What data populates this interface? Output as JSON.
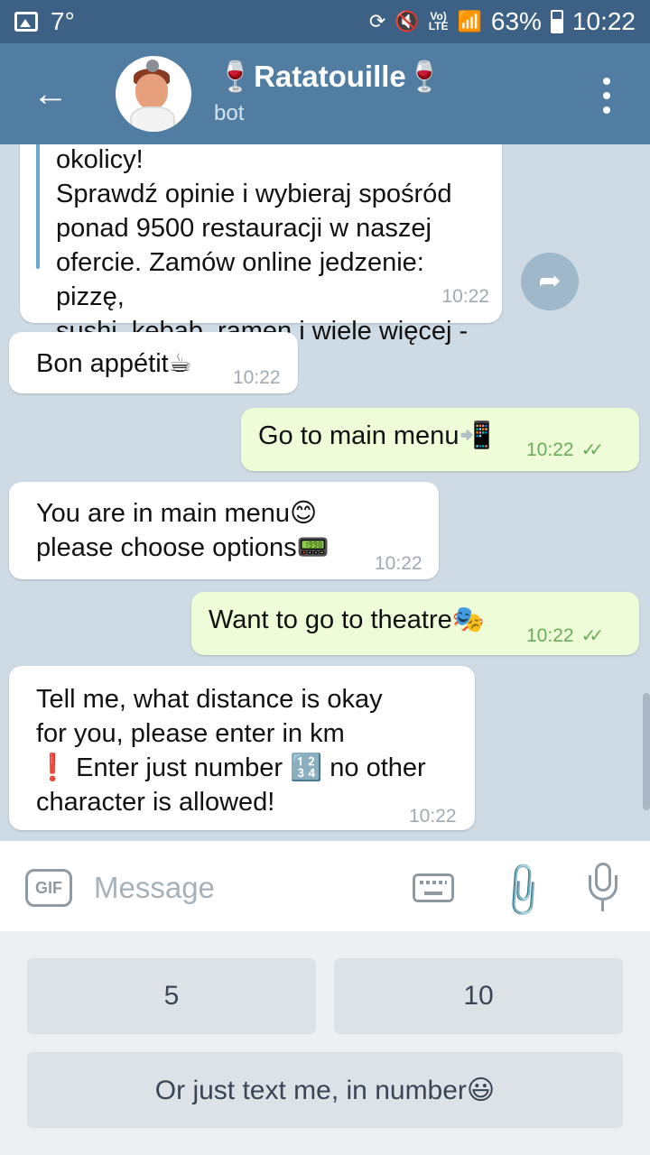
{
  "status_bar": {
    "temperature": "7°",
    "lte_label": "Vo)\nLTE",
    "battery": "63%",
    "time": "10:22"
  },
  "header": {
    "title": "🍷Ratatouille🍷",
    "subtitle": "bot"
  },
  "messages": [
    {
      "direction": "in",
      "text": "restauracje i pizzerie w Twojej okolicy!\nSprawdź opinie i wybieraj spośród\nponad 9500 restauracji w naszej\nofercie. Zamów online jedzenie: pizzę,\nsushi, kebab, ramen i wiele więcej - p...",
      "time": "10:22"
    },
    {
      "direction": "in",
      "text": "Bon appétit☕",
      "time": "10:22"
    },
    {
      "direction": "out",
      "text": "Go to main menu📲",
      "time": "10:22"
    },
    {
      "direction": "in",
      "text": "You are in main menu😊\nplease choose options📟",
      "time": "10:22"
    },
    {
      "direction": "out",
      "text": "Want to go to theatre🎭",
      "time": "10:22"
    },
    {
      "direction": "in",
      "text": "Tell me, what distance is okay\nfor you, please enter in km\n❗ Enter just number 🔢 no other\ncharacter is allowed!",
      "time": "10:22"
    }
  ],
  "input": {
    "gif_label": "GIF",
    "placeholder": "Message"
  },
  "bot_keyboard": {
    "buttons": [
      "5",
      "10",
      "Or just text me, in number😃"
    ]
  },
  "colors": {
    "header": "#517da2",
    "status_bar": "#3d6184",
    "outgoing_bubble": "#eefdd8",
    "incoming_bubble": "#ffffff",
    "chat_background": "#cfdbe4"
  },
  "icons": [
    "gallery-icon",
    "mute-icon",
    "wifi-icon",
    "signal-icon",
    "battery-icon",
    "back-arrow-icon",
    "more-vertical-icon",
    "share-arrow-icon",
    "keyboard-icon",
    "paperclip-icon",
    "microphone-icon",
    "double-check-icon"
  ]
}
